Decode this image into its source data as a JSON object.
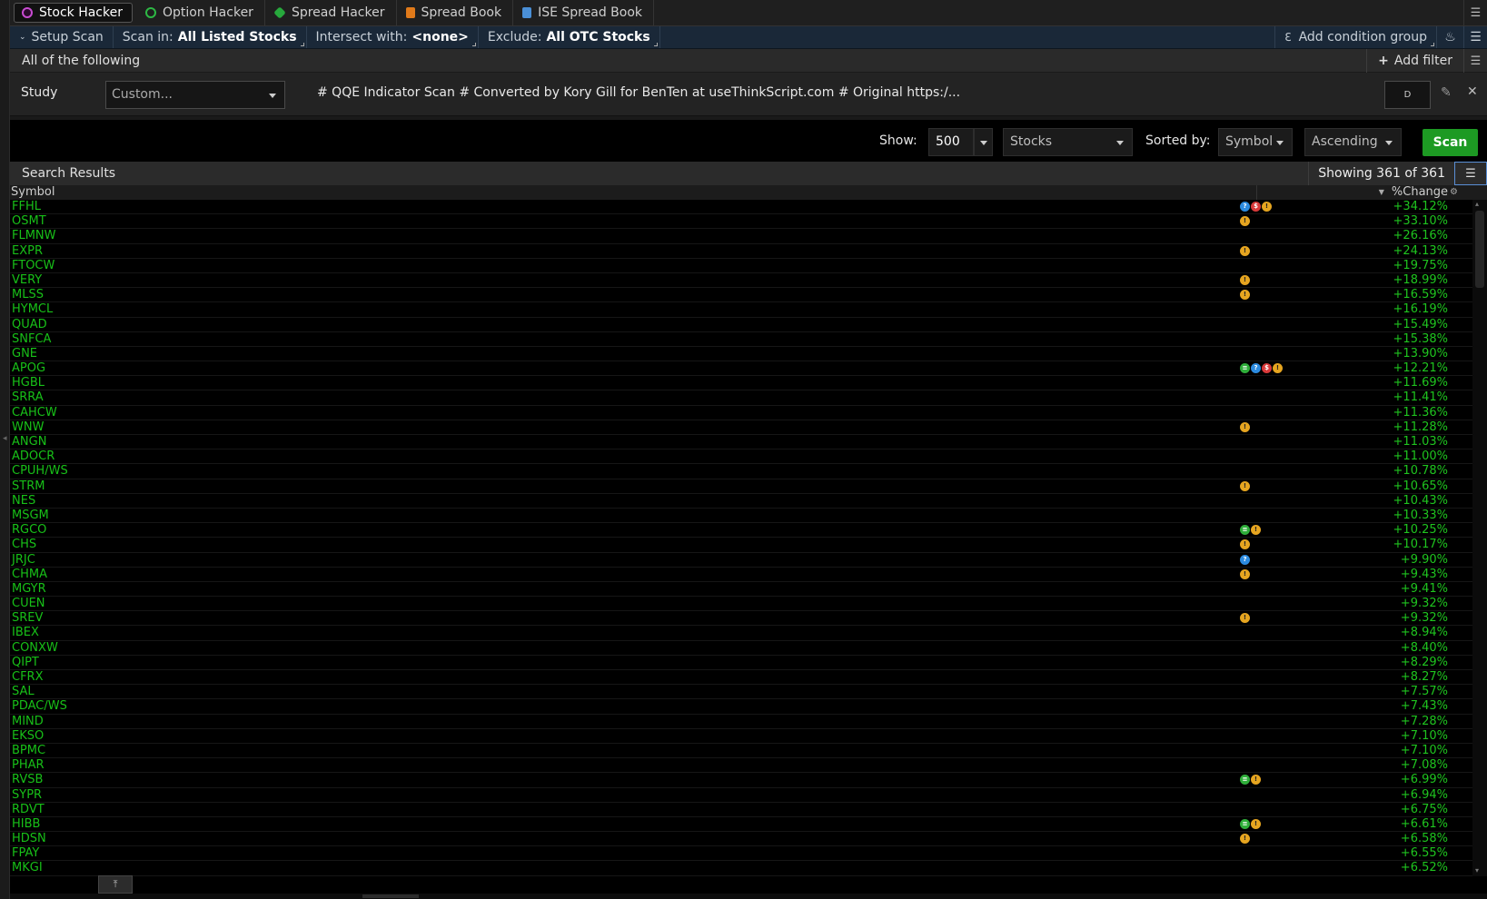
{
  "tabs": [
    {
      "label": "Stock Hacker",
      "icon": "stock-hacker-icon",
      "active": true
    },
    {
      "label": "Option Hacker",
      "icon": "option-hacker-icon"
    },
    {
      "label": "Spread Hacker",
      "icon": "spread-hacker-icon"
    },
    {
      "label": "Spread Book",
      "icon": "spread-book-icon"
    },
    {
      "label": "ISE Spread Book",
      "icon": "ise-spread-book-icon"
    }
  ],
  "scanbar": {
    "setup_label": "Setup Scan",
    "scan_in_label": "Scan in:",
    "scan_in_value": "All Listed Stocks",
    "intersect_label": "Intersect with:",
    "intersect_value": "<none>",
    "exclude_label": "Exclude:",
    "exclude_value": "All OTC Stocks",
    "add_group_label": "Add condition group"
  },
  "conditions": {
    "header": "All of the following",
    "add_filter_label": "Add filter"
  },
  "study": {
    "label": "Study",
    "select_value": "Custom...",
    "script_text": "# QQE Indicator Scan # Converted by Kory Gill for BenTen at useThinkScript.com # Original https:/...",
    "aggregation": "D"
  },
  "controls": {
    "show_label": "Show:",
    "show_value": "500",
    "type_value": "Stocks",
    "sorted_label": "Sorted by:",
    "sort_field": "Symbol",
    "sort_order": "Ascending",
    "scan_button": "Scan"
  },
  "results": {
    "title": "Search Results",
    "count_text": "Showing 361 of 361",
    "col_symbol": "Symbol",
    "col_change": "%Change",
    "rows": [
      {
        "symbol": "FFHL",
        "change": "+34.12%",
        "events": [
          "e",
          "d",
          "s"
        ]
      },
      {
        "symbol": "OSMT",
        "change": "+33.10%",
        "events": [
          "e"
        ]
      },
      {
        "symbol": "FLMNW",
        "change": "+26.16%",
        "events": []
      },
      {
        "symbol": "EXPR",
        "change": "+24.13%",
        "events": [
          "e"
        ]
      },
      {
        "symbol": "FTOCW",
        "change": "+19.75%",
        "events": []
      },
      {
        "symbol": "VERY",
        "change": "+18.99%",
        "events": [
          "e"
        ]
      },
      {
        "symbol": "MLSS",
        "change": "+16.59%",
        "events": [
          "e"
        ]
      },
      {
        "symbol": "HYMCL",
        "change": "+16.19%",
        "events": []
      },
      {
        "symbol": "QUAD",
        "change": "+15.49%",
        "events": []
      },
      {
        "symbol": "SNFCA",
        "change": "+15.38%",
        "events": []
      },
      {
        "symbol": "GNE",
        "change": "+13.90%",
        "events": []
      },
      {
        "symbol": "APOG",
        "change": "+12.21%",
        "events": [
          "e",
          "d",
          "s",
          "c"
        ]
      },
      {
        "symbol": "HGBL",
        "change": "+11.69%",
        "events": []
      },
      {
        "symbol": "SRRA",
        "change": "+11.41%",
        "events": []
      },
      {
        "symbol": "CAHCW",
        "change": "+11.36%",
        "events": []
      },
      {
        "symbol": "WNW",
        "change": "+11.28%",
        "events": [
          "e"
        ]
      },
      {
        "symbol": "ANGN",
        "change": "+11.03%",
        "events": []
      },
      {
        "symbol": "ADOCR",
        "change": "+11.00%",
        "events": []
      },
      {
        "symbol": "CPUH/WS",
        "change": "+10.78%",
        "events": []
      },
      {
        "symbol": "STRM",
        "change": "+10.65%",
        "events": [
          "e"
        ]
      },
      {
        "symbol": "NES",
        "change": "+10.43%",
        "events": []
      },
      {
        "symbol": "MSGM",
        "change": "+10.33%",
        "events": []
      },
      {
        "symbol": "RGCO",
        "change": "+10.25%",
        "events": [
          "e",
          "c"
        ]
      },
      {
        "symbol": "CHS",
        "change": "+10.17%",
        "events": [
          "e"
        ]
      },
      {
        "symbol": "JRJC",
        "change": "+9.90%",
        "events": [
          "s"
        ]
      },
      {
        "symbol": "CHMA",
        "change": "+9.43%",
        "events": [
          "e"
        ]
      },
      {
        "symbol": "MGYR",
        "change": "+9.41%",
        "events": []
      },
      {
        "symbol": "CUEN",
        "change": "+9.32%",
        "events": []
      },
      {
        "symbol": "SREV",
        "change": "+9.32%",
        "events": [
          "e"
        ]
      },
      {
        "symbol": "IBEX",
        "change": "+8.94%",
        "events": []
      },
      {
        "symbol": "CONXW",
        "change": "+8.40%",
        "events": []
      },
      {
        "symbol": "QIPT",
        "change": "+8.29%",
        "events": []
      },
      {
        "symbol": "CFRX",
        "change": "+8.27%",
        "events": []
      },
      {
        "symbol": "SAL",
        "change": "+7.57%",
        "events": []
      },
      {
        "symbol": "PDAC/WS",
        "change": "+7.43%",
        "events": []
      },
      {
        "symbol": "MIND",
        "change": "+7.28%",
        "events": []
      },
      {
        "symbol": "EKSO",
        "change": "+7.10%",
        "events": []
      },
      {
        "symbol": "BPMC",
        "change": "+7.10%",
        "events": []
      },
      {
        "symbol": "PHAR",
        "change": "+7.08%",
        "events": []
      },
      {
        "symbol": "RVSB",
        "change": "+6.99%",
        "events": [
          "e",
          "c"
        ]
      },
      {
        "symbol": "SYPR",
        "change": "+6.94%",
        "events": []
      },
      {
        "symbol": "RDVT",
        "change": "+6.75%",
        "events": []
      },
      {
        "symbol": "HIBB",
        "change": "+6.61%",
        "events": [
          "e",
          "c"
        ]
      },
      {
        "symbol": "HDSN",
        "change": "+6.58%",
        "events": [
          "e"
        ]
      },
      {
        "symbol": "FPAY",
        "change": "+6.55%",
        "events": []
      },
      {
        "symbol": "MKGI",
        "change": "+6.52%",
        "events": []
      }
    ]
  },
  "colors": {
    "positive": "#1fc41f",
    "scan_button": "#1d9a23",
    "scanbar_bg": "#1a2838"
  }
}
